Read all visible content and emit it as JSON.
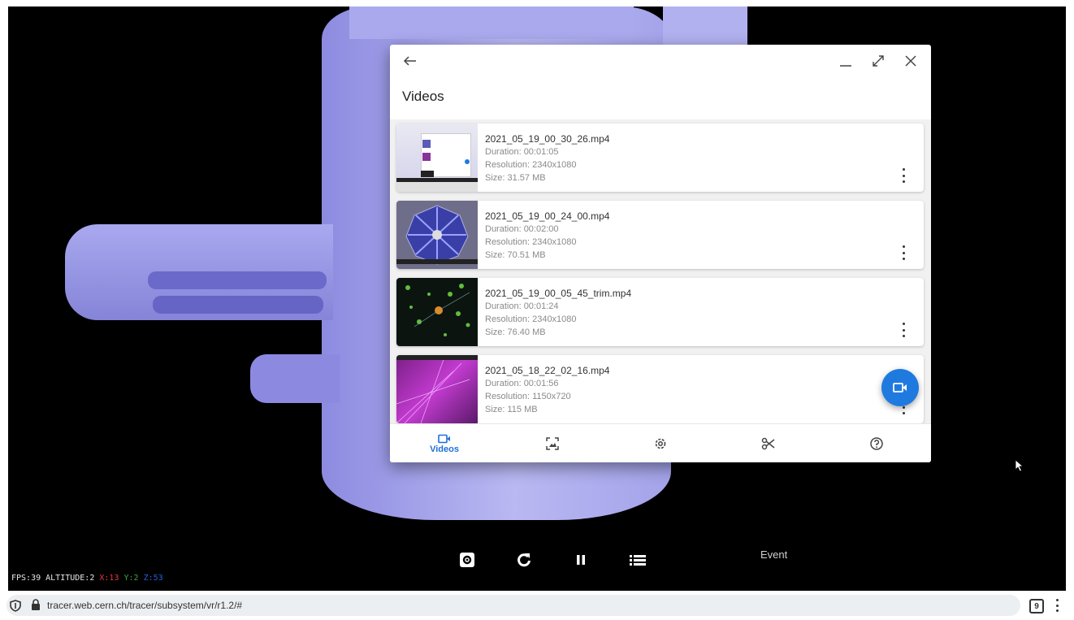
{
  "overlay": {
    "fps_label": "FPS:39 ALTITUDE:2",
    "x_label": "X:13",
    "y_label": "Y:2",
    "z_label": "Z:53",
    "event_label": "Event"
  },
  "dialog": {
    "title": "Videos",
    "videos": [
      {
        "filename": "2021_05_19_00_30_26.mp4",
        "duration": "Duration: 00:01:05",
        "resolution": "Resolution: 2340x1080",
        "size": "Size: 31.57 MB"
      },
      {
        "filename": "2021_05_19_00_24_00.mp4",
        "duration": "Duration: 00:02:00",
        "resolution": "Resolution: 2340x1080",
        "size": "Size: 70.51 MB"
      },
      {
        "filename": "2021_05_19_00_05_45_trim.mp4",
        "duration": "Duration: 00:01:24",
        "resolution": "Resolution: 2340x1080",
        "size": "Size: 76.40 MB"
      },
      {
        "filename": "2021_05_18_22_02_16.mp4",
        "duration": "Duration: 00:01:56",
        "resolution": "Resolution: 1150x720",
        "size": "Size: 115 MB"
      }
    ],
    "nav": {
      "videos_label": "Videos"
    }
  },
  "browser": {
    "url": "tracer.web.cern.ch/tracer/subsystem/vr/r1.2/#",
    "tab_count": "9"
  },
  "colors": {
    "accent": "#1f7ae0",
    "scene_shape": "#9c9be8"
  }
}
